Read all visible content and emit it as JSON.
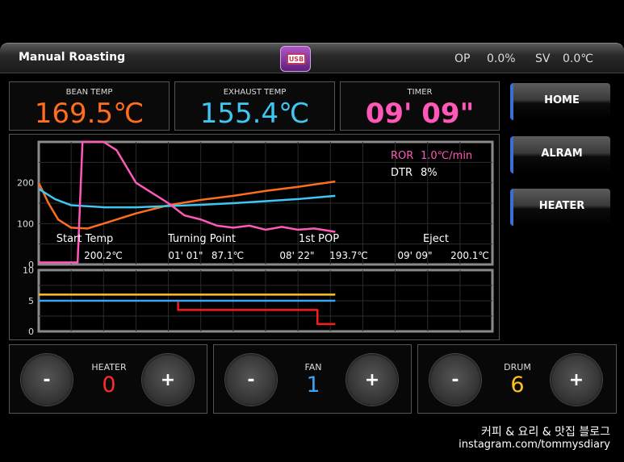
{
  "header": {
    "title": "Manual Roasting",
    "usb_label": "USB",
    "op_label": "OP",
    "op_value": "0.0%",
    "sv_label": "SV",
    "sv_value": "0.0℃"
  },
  "readouts": {
    "bean": {
      "label": "BEAN TEMP",
      "value": "169.5℃"
    },
    "exhaust": {
      "label": "EXHAUST TEMP",
      "value": "155.4℃"
    },
    "timer": {
      "label": "TIMER",
      "value": "09' 09\""
    }
  },
  "side_buttons": {
    "home": "HOME",
    "alram": "ALRAM",
    "heater": "HEATER"
  },
  "controls": {
    "heater": {
      "label": "HEATER",
      "value": "0",
      "minus": "-",
      "plus": "+"
    },
    "fan": {
      "label": "FAN",
      "value": "1",
      "minus": "-",
      "plus": "+"
    },
    "drum": {
      "label": "DRUM",
      "value": "6",
      "minus": "-",
      "plus": "+"
    }
  },
  "chart_data": [
    {
      "type": "line",
      "ylim": [
        0,
        300
      ],
      "xlim": [
        0,
        14
      ],
      "y_ticks": [
        "200",
        "100",
        "0"
      ],
      "y_tick_values": [
        200,
        100,
        0
      ],
      "series": [
        {
          "color": "#ff6d1f",
          "x": [
            0,
            0.3,
            0.6,
            1.0,
            1.5,
            2.0,
            3,
            4,
            5,
            6,
            7,
            8,
            9.15
          ],
          "y": [
            200,
            150,
            110,
            90,
            88,
            100,
            125,
            145,
            158,
            168,
            180,
            190,
            203
          ]
        },
        {
          "color": "#3ec7f2",
          "x": [
            0,
            0.5,
            1.0,
            2,
            3,
            4,
            5,
            6,
            7,
            8,
            9.15
          ],
          "y": [
            185,
            160,
            145,
            140,
            140,
            143,
            146,
            150,
            155,
            160,
            168
          ]
        },
        {
          "color": "#ff58b8",
          "x": [
            0,
            1.2,
            1.35,
            1.5,
            2.0,
            2.4,
            2.7,
            3.0,
            3.5,
            4,
            4.5,
            5,
            5.5,
            6,
            6.5,
            7,
            7.5,
            8,
            8.5,
            9.15
          ],
          "y": [
            5,
            5,
            300,
            300,
            300,
            280,
            240,
            200,
            175,
            150,
            120,
            110,
            95,
            90,
            95,
            85,
            92,
            85,
            88,
            80
          ]
        }
      ],
      "ror_label": "ROR",
      "ror_value": "1.0℃/min",
      "dtr_label": "DTR",
      "dtr_value": "8%",
      "events": [
        {
          "name": "Start Temp",
          "time": "",
          "temp": "200.2℃"
        },
        {
          "name": "Turning Point",
          "time": "01'  01\"",
          "temp": "87.1℃"
        },
        {
          "name": "1st POP",
          "time": "08'  22\"",
          "temp": "193.7℃"
        },
        {
          "name": "Eject",
          "time": "09'  09\"",
          "temp": "200.1℃"
        }
      ]
    },
    {
      "type": "line",
      "ylim": [
        0,
        10
      ],
      "xlim": [
        0,
        14
      ],
      "y_ticks": [
        "10",
        "5",
        "0"
      ],
      "y_tick_values": [
        10,
        5,
        0
      ],
      "series": [
        {
          "color": "#ffc21a",
          "x": [
            0,
            9.15
          ],
          "y": [
            6,
            6
          ]
        },
        {
          "color": "#3ea2f2",
          "x": [
            0,
            9.15
          ],
          "y": [
            5,
            5
          ]
        },
        {
          "color": "#ff1a1a",
          "x": [
            4.3,
            4.3,
            8.6,
            8.6,
            9.15
          ],
          "y": [
            4.8,
            3.5,
            3.5,
            1.2,
            1.2
          ]
        }
      ]
    }
  ],
  "watermark": {
    "line1": "커피 & 요리 & 맛집 블로그",
    "line2": "instagram.com/tommysdiary"
  }
}
